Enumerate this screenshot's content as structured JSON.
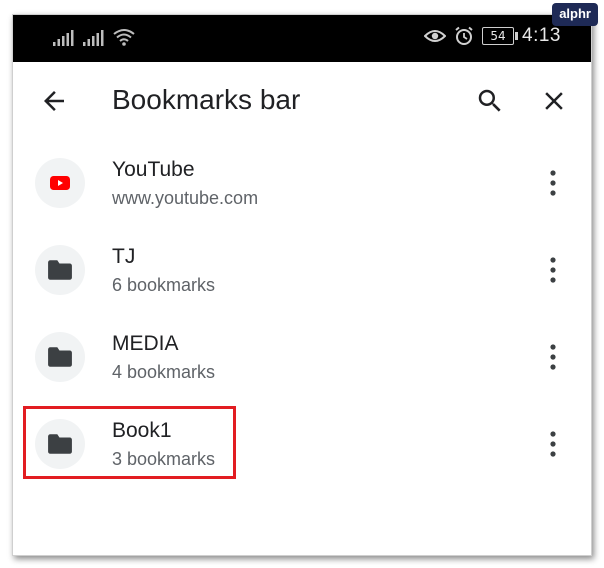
{
  "watermark": {
    "text": "alphr"
  },
  "status_bar": {
    "time": "4:13",
    "battery": "54",
    "icons": [
      "signal-icon",
      "signal-icon",
      "wifi-icon",
      "eye-icon",
      "alarm-icon",
      "battery-icon"
    ]
  },
  "toolbar": {
    "title": "Bookmarks bar",
    "back_icon": "arrow-left-icon",
    "search_icon": "search-icon",
    "close_icon": "close-icon"
  },
  "bookmarks": [
    {
      "title": "YouTube",
      "subtitle": "www.youtube.com",
      "icon": "youtube-icon"
    },
    {
      "title": "TJ",
      "subtitle": "6 bookmarks",
      "icon": "folder-icon"
    },
    {
      "title": "MEDIA",
      "subtitle": "4 bookmarks",
      "icon": "folder-icon"
    },
    {
      "title": "Book1",
      "subtitle": "3 bookmarks",
      "icon": "folder-icon"
    }
  ],
  "colors": {
    "highlight": "#e21c21",
    "youtube_red": "#ff0000",
    "folder": "#3c4043",
    "avatar_bg": "#f1f3f4"
  }
}
